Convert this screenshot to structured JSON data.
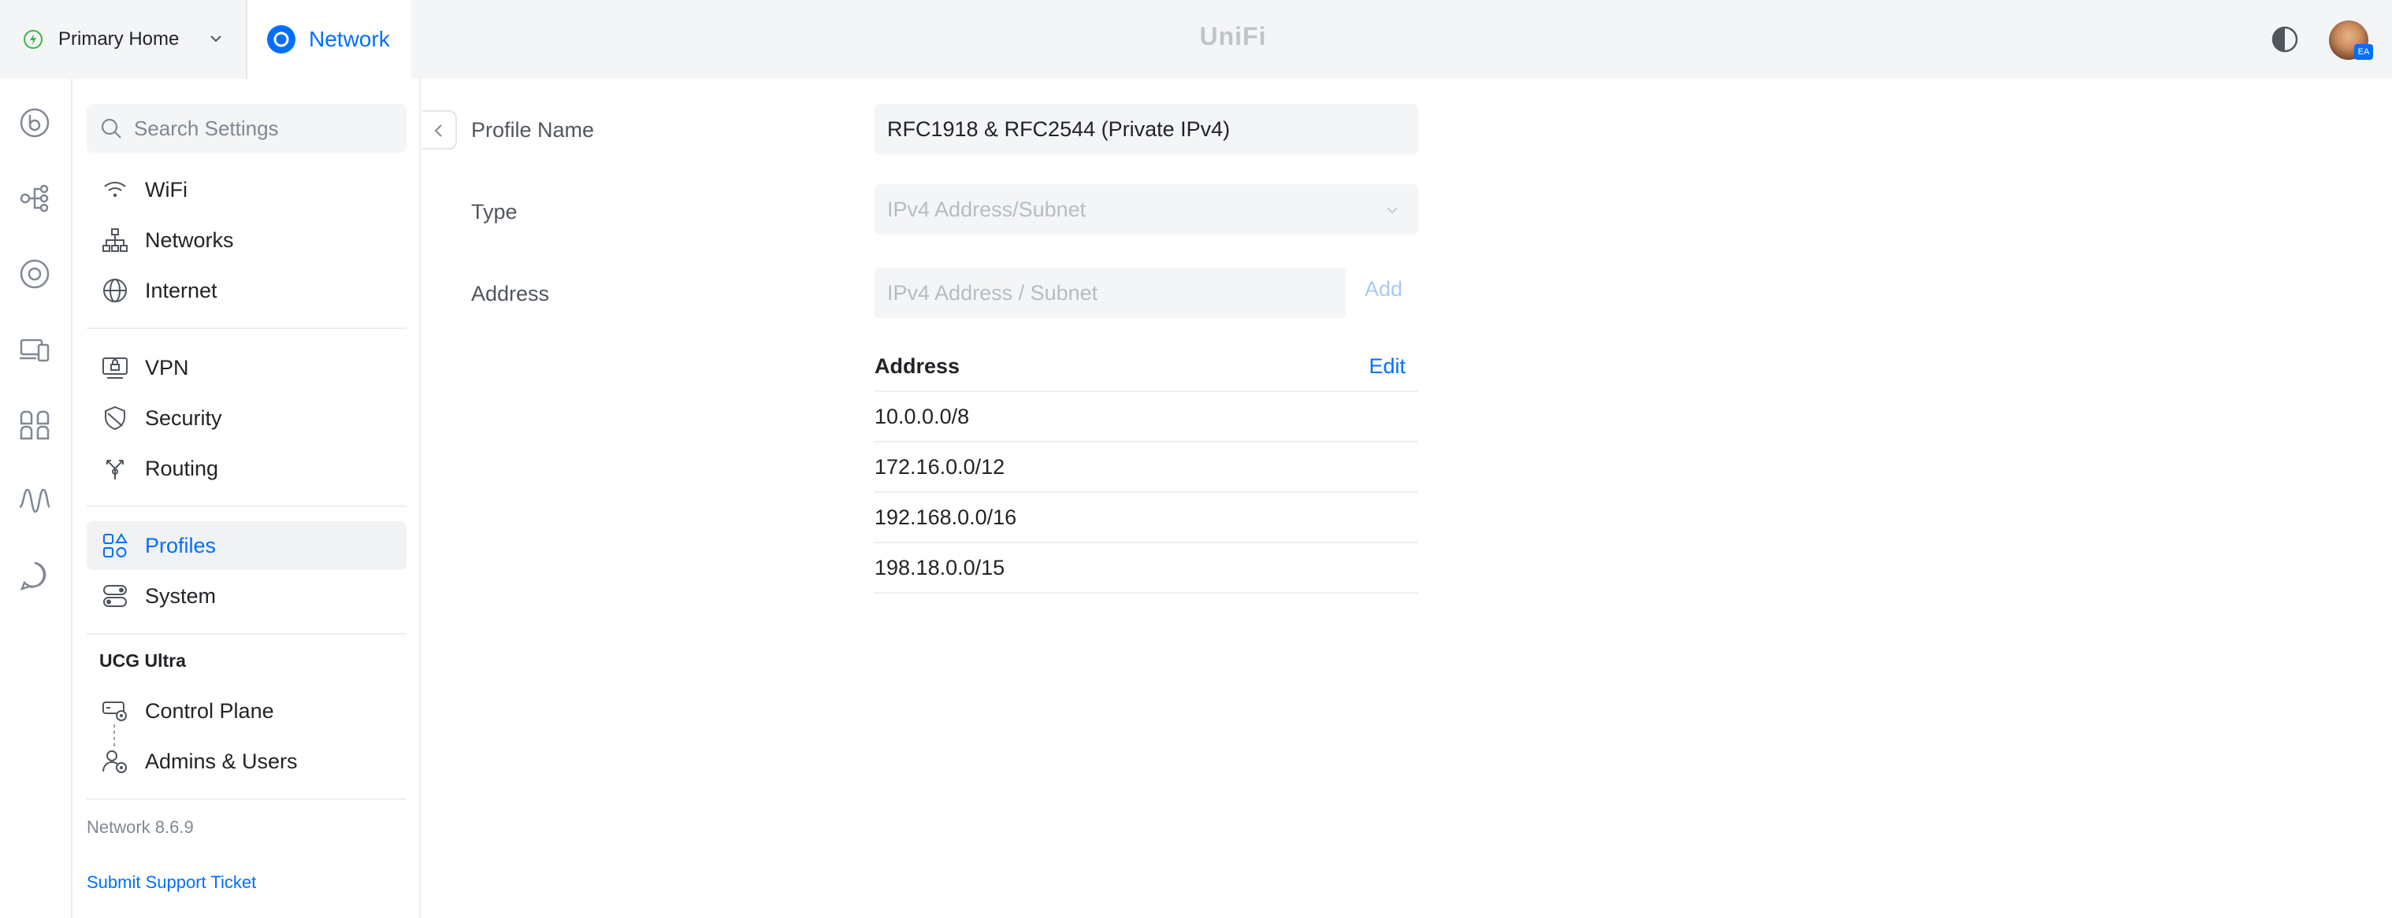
{
  "topbar": {
    "site_name": "Primary Home",
    "app_tab": "Network",
    "brand": "UniFi",
    "avatar_initials": "EA"
  },
  "search": {
    "placeholder": "Search Settings"
  },
  "sidebar": {
    "items": [
      {
        "label": "WiFi",
        "icon": "wifi-icon"
      },
      {
        "label": "Networks",
        "icon": "networks-icon"
      },
      {
        "label": "Internet",
        "icon": "globe-icon"
      },
      {
        "label": "VPN",
        "icon": "vpn-icon"
      },
      {
        "label": "Security",
        "icon": "shield-icon"
      },
      {
        "label": "Routing",
        "icon": "routing-icon"
      },
      {
        "label": "Profiles",
        "icon": "profiles-icon",
        "active": true
      },
      {
        "label": "System",
        "icon": "toggles-icon"
      }
    ],
    "section_title": "UCG Ultra",
    "device_items": [
      {
        "label": "Control Plane",
        "icon": "control-plane-icon"
      },
      {
        "label": "Admins & Users",
        "icon": "admins-icon"
      }
    ],
    "version": "Network 8.6.9",
    "support_link": "Submit Support Ticket"
  },
  "form": {
    "profile_name_label": "Profile Name",
    "profile_name_value": "RFC1918 & RFC2544 (Private IPv4)",
    "type_label": "Type",
    "type_value": "IPv4 Address/Subnet",
    "address_label": "Address",
    "address_placeholder": "IPv4 Address / Subnet",
    "add_label": "Add"
  },
  "address_table": {
    "header": "Address",
    "edit_label": "Edit",
    "rows": [
      "10.0.0.0/8",
      "172.16.0.0/12",
      "192.168.0.0/16",
      "198.18.0.0/15"
    ]
  },
  "colors": {
    "accent": "#006fff",
    "rail_icon": "#808893",
    "active_bg": "#f0f2f4",
    "field_bg": "#f4f5f6"
  }
}
